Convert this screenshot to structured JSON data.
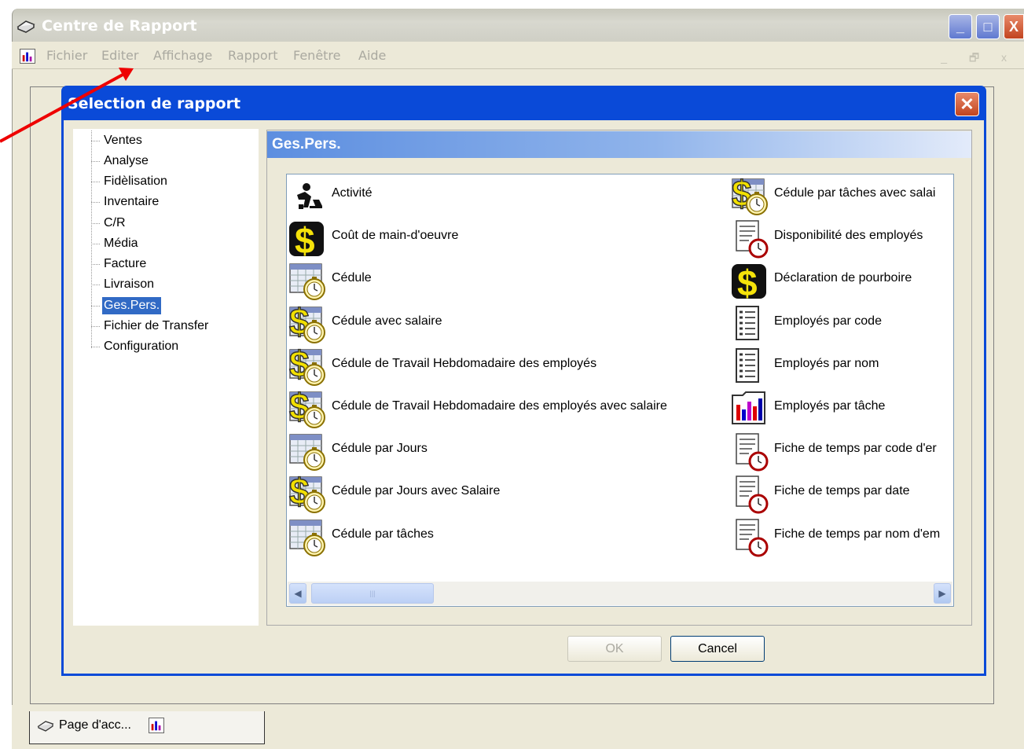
{
  "window": {
    "title": "Centre de Rapport",
    "minimize_glyph": "_",
    "maximize_glyph": "□",
    "close_glyph": "X",
    "icon": "printer-icon"
  },
  "menu": {
    "items": [
      "Fichier",
      "Editer",
      "Affichage",
      "Rapport",
      "Fenêtre",
      "Aide"
    ],
    "mdi_controls": "_ 🗗 x"
  },
  "dialog": {
    "title": "Selection de rapport",
    "close_glyph": "✕"
  },
  "tree": {
    "items": [
      "Ventes",
      "Analyse",
      "Fidèlisation",
      "Inventaire",
      "C/R",
      "Média",
      "Facture",
      "Livraison",
      "Ges.Pers.",
      "Fichier de Transfer",
      "Configuration"
    ],
    "selected": "Ges.Pers."
  },
  "report_panel": {
    "header": "Ges.Pers.",
    "left_column": [
      {
        "label": "Activité",
        "icon": "activity-icon"
      },
      {
        "label": "Coût de main-d'oeuvre",
        "icon": "dollar-icon"
      },
      {
        "label": "Cédule",
        "icon": "calendar-stopwatch-icon"
      },
      {
        "label": "Cédule avec salaire",
        "icon": "salary-schedule-icon"
      },
      {
        "label": "Cédule de Travail Hebdomadaire des employés",
        "icon": "salary-schedule-icon"
      },
      {
        "label": "Cédule de Travail Hebdomadaire des employés avec salaire",
        "icon": "salary-schedule-icon"
      },
      {
        "label": "Cédule par Jours",
        "icon": "calendar-stopwatch-icon"
      },
      {
        "label": "Cédule par Jours avec Salaire",
        "icon": "salary-schedule-icon"
      },
      {
        "label": "Cédule par tâches",
        "icon": "calendar-stopwatch-icon"
      }
    ],
    "right_column": [
      {
        "label": "Cédule par tâches avec salai",
        "icon": "salary-schedule-icon"
      },
      {
        "label": "Disponibilité des employés",
        "icon": "document-clock-icon"
      },
      {
        "label": "Déclaration de pourboire",
        "icon": "dollar-icon"
      },
      {
        "label": "Employés par code",
        "icon": "document-list-icon"
      },
      {
        "label": "Employés par nom",
        "icon": "document-list-icon"
      },
      {
        "label": "Employés par tâche",
        "icon": "bar-chart-icon"
      },
      {
        "label": "Fiche de temps par code d'er",
        "icon": "document-clock-icon"
      },
      {
        "label": "Fiche de temps par date",
        "icon": "document-clock-icon"
      },
      {
        "label": "Fiche de temps par nom d'em",
        "icon": "document-clock-icon"
      }
    ]
  },
  "buttons": {
    "ok": "OK",
    "cancel": "Cancel"
  },
  "taskbar": {
    "tab_label": "Page d'acc..."
  }
}
